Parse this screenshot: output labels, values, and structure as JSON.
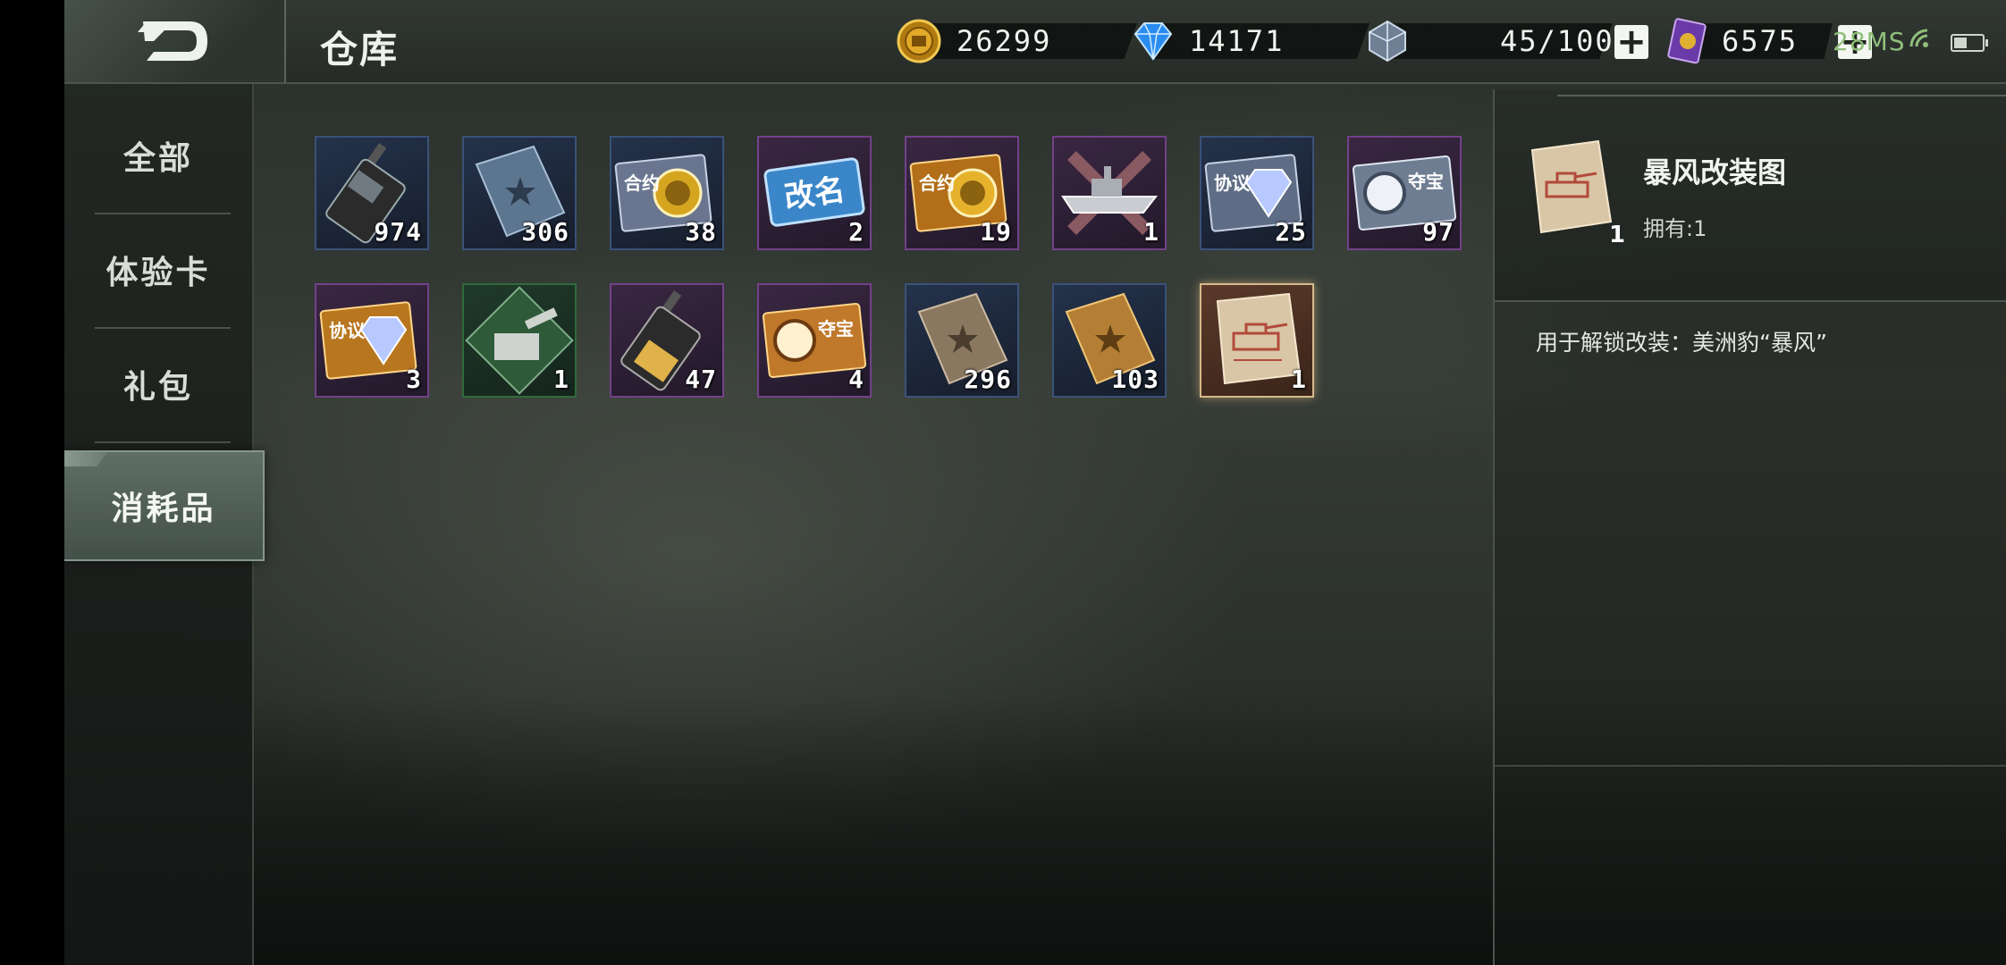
{
  "header": {
    "title": "仓库",
    "gold": "26299",
    "diamond": "14171",
    "stamina": "45/100",
    "tickets": "6575",
    "ping": "28MS",
    "plus_label": "+"
  },
  "sidebar": {
    "tabs": [
      {
        "label": "全部"
      },
      {
        "label": "体验卡"
      },
      {
        "label": "礼包"
      },
      {
        "label": "消耗品",
        "active": true
      }
    ]
  },
  "items": [
    {
      "icon": "walkie-talkie-icon",
      "count": "974"
    },
    {
      "icon": "blue-manual-icon",
      "count": "306"
    },
    {
      "icon": "contract-coin-ticket-icon",
      "count": "38"
    },
    {
      "icon": "rename-card-icon",
      "count": "2"
    },
    {
      "icon": "contract-gold-ticket-icon",
      "count": "19"
    },
    {
      "icon": "warship-blueprint-icon",
      "count": "1"
    },
    {
      "icon": "agreement-diamond-ticket-icon",
      "count": "25"
    },
    {
      "icon": "treasure-ticket-silver-icon",
      "count": "97"
    },
    {
      "icon": "agreement-diamond-gold-ticket-icon",
      "count": "3"
    },
    {
      "icon": "artillery-blueprint-icon",
      "count": "1"
    },
    {
      "icon": "gold-walkie-talkie-icon",
      "count": "47"
    },
    {
      "icon": "treasure-ticket-gold-icon",
      "count": "4"
    },
    {
      "icon": "bronze-manual-icon",
      "count": "296"
    },
    {
      "icon": "gold-manual-icon",
      "count": "103"
    },
    {
      "icon": "tank-mod-blueprint-icon",
      "count": "1"
    }
  ],
  "item_labels": {
    "contract": "合约",
    "rename": "改名",
    "agreement": "协议",
    "treasure": "夺宝"
  },
  "detail": {
    "name": "暴风改装图",
    "owned": "拥有:1",
    "count": "1",
    "description": "用于解锁改装：美洲豹“暴风”"
  }
}
